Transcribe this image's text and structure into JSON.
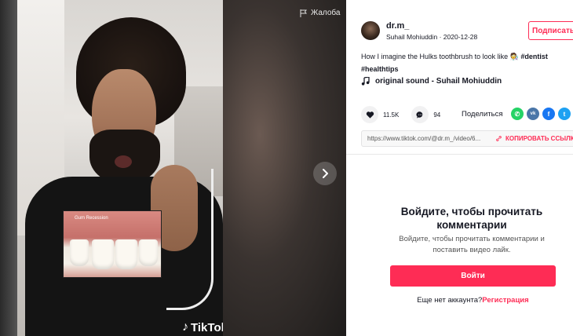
{
  "video": {
    "report_label": "Жалоба",
    "image_label": "Gum Recession",
    "watermark": "TikTok"
  },
  "post": {
    "username": "dr.m_",
    "display_name": "Suhail Mohiuddin",
    "date": "2020-12-28",
    "meta_separator": " · ",
    "follow_label": "Подписаться",
    "description": "How I imagine the Hulks toothbrush to look like 🧑‍🔬 ",
    "hashtags": [
      "#dentist",
      "#healthtips"
    ],
    "sound": "original sound - Suhail Mohiuddin"
  },
  "stats": {
    "likes": "11.5K",
    "comments": "94",
    "share_label": "Поделиться"
  },
  "share_icons": [
    {
      "name": "whatsapp-icon",
      "glyph": "✆",
      "color": "#25d366"
    },
    {
      "name": "vk-icon",
      "glyph": "vk",
      "color": "#4a76a8"
    },
    {
      "name": "facebook-icon",
      "glyph": "f",
      "color": "#1877f2"
    },
    {
      "name": "twitter-icon",
      "glyph": "t",
      "color": "#1da1f2"
    }
  ],
  "link": {
    "url": "https://www.tiktok.com/@dr.m_/video/6...",
    "copy_label": "КОПИРОВАТЬ ССЫЛКУ"
  },
  "login": {
    "title": "Войдите, чтобы прочитать комментарии",
    "subtitle": "Войдите, чтобы прочитать комментарии и поставить видео лайк.",
    "button": "Войти",
    "no_account": "Еще нет аккаунта?",
    "register": "Регистрация"
  },
  "colors": {
    "accent": "#fe2c55",
    "text": "#161823"
  }
}
